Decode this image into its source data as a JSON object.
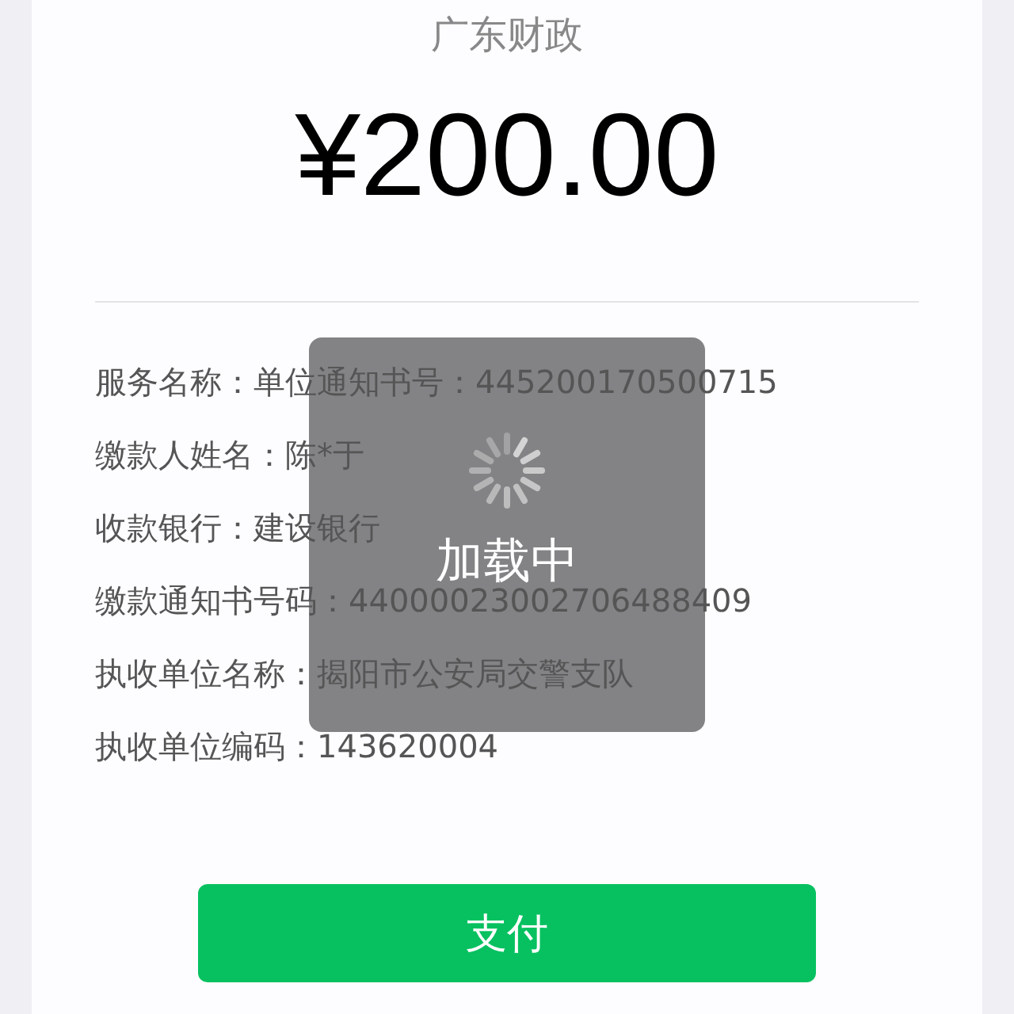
{
  "payee": "广东财政",
  "amount": "¥200.00",
  "details": [
    {
      "label": "服务名称：",
      "value": "单位通知书号：445200170500715"
    },
    {
      "label": "缴款人姓名：",
      "value": "陈*于"
    },
    {
      "label": "收款银行：",
      "value": "建设银行"
    },
    {
      "label": "缴款通知书号码：",
      "value": "44000023002706488409"
    },
    {
      "label": "执收单位名称：",
      "value": "揭阳市公安局交警支队"
    },
    {
      "label": "执收单位编码：",
      "value": "143620004"
    }
  ],
  "pay_button": "支付",
  "loading_toast": {
    "text": "加载中"
  }
}
